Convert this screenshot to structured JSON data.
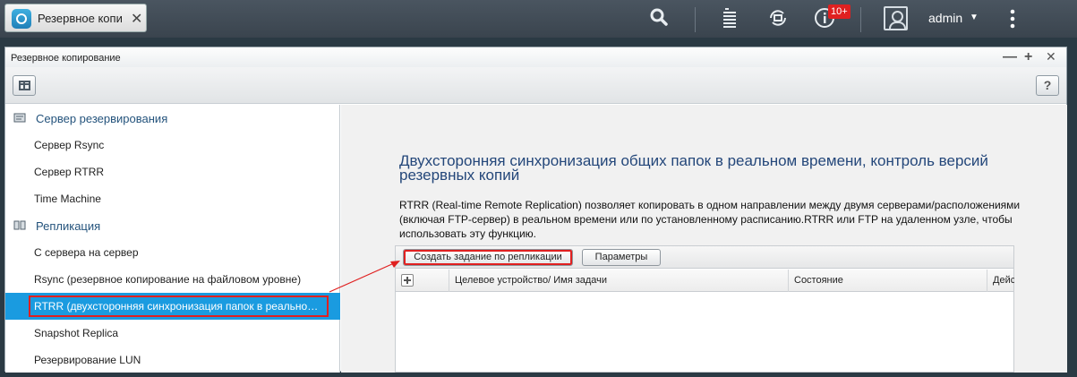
{
  "topbar": {
    "app_tab_title": "Резервное копи",
    "close_symbol": "✕",
    "search_symbol": "⚲",
    "notifications_badge": "10+",
    "username": "admin",
    "caret": "▼",
    "more_symbol": "⋮"
  },
  "window": {
    "title": "Резервное копирование",
    "min_symbol": "—",
    "max_symbol": "+",
    "close_symbol": "✕",
    "help_label": "?"
  },
  "sidebar": {
    "groups": [
      {
        "label": "Сервер резервирования",
        "icon": "server-icon",
        "items": [
          "Сервер Rsync",
          "Сервер RTRR",
          "Time Machine"
        ]
      },
      {
        "label": "Репликация",
        "icon": "replication-icon",
        "items": [
          "С сервера на сервер",
          "Rsync (резервное копирование на файловом уровне)",
          "RTRR (двухсторонняя синхронизация папок в реально…",
          "Snapshot Replica",
          "Резервирование LUN"
        ]
      }
    ],
    "active_item": "RTRR (двухсторонняя синхронизация папок в реально…"
  },
  "main": {
    "headline": "Двухсторонняя синхронизация общих папок в реальном времени, контроль версий резервных копий",
    "description": "RTRR (Real-time Remote Replication) позволяет копировать в одном направлении между двумя серверами/расположениями (включая FTP-сервер) в реальном времени или по установленному расписанию.RTRR или FTP на удаленном узле, чтобы использовать эту функцию.",
    "buttons": {
      "create_job": "Создать задание по репликации",
      "settings": "Параметры"
    },
    "table": {
      "columns": [
        "",
        "Целевое устройство/ Имя задачи",
        "Состояние",
        "Дейс"
      ],
      "rows": []
    }
  },
  "colors": {
    "accent": "#1a9be0",
    "highlight": "#e02020",
    "heading": "#24477a"
  }
}
